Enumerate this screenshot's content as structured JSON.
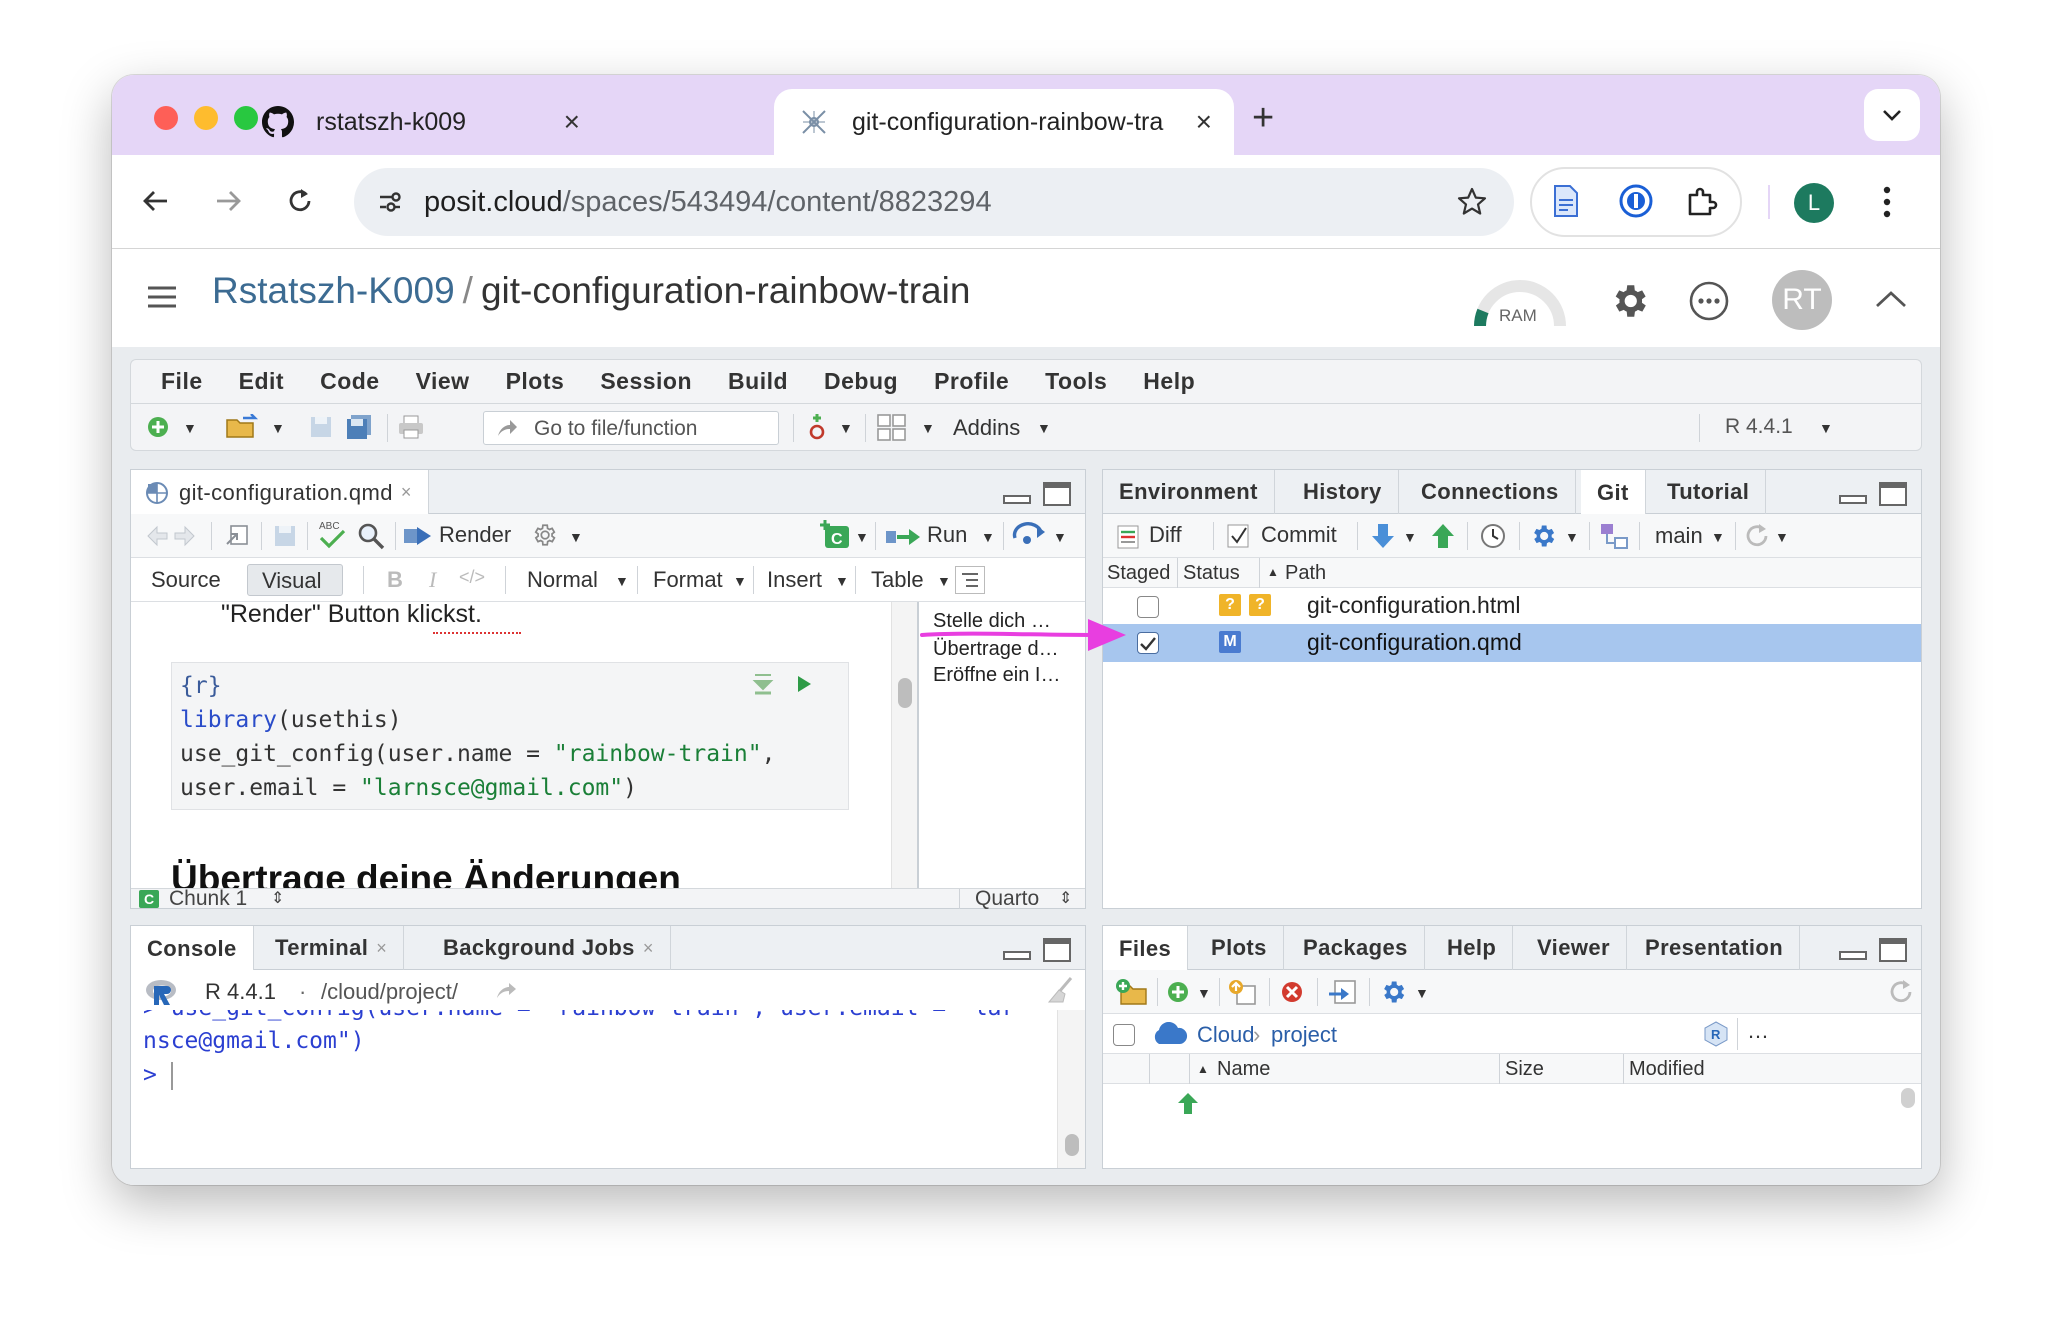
{
  "browser": {
    "tabs": [
      {
        "title": "rstatszh-k009",
        "icon": "github-icon"
      },
      {
        "title": "git-configuration-rainbow-tra",
        "icon": "posit-icon"
      }
    ],
    "url_domain": "posit.cloud",
    "url_path": "/spaces/543494/content/8823294",
    "profile_initial": "L"
  },
  "posit": {
    "space": "Rstatszh-K009",
    "separator": "/",
    "project": "git-configuration-rainbow-train",
    "ram_label": "RAM",
    "user_initials": "RT"
  },
  "menu": [
    "File",
    "Edit",
    "Code",
    "View",
    "Plots",
    "Session",
    "Build",
    "Debug",
    "Profile",
    "Tools",
    "Help"
  ],
  "main_toolbar": {
    "goto_placeholder": "Go to file/function",
    "addins": "Addins",
    "r_version": "R 4.4.1"
  },
  "editor": {
    "file_tab": "git-configuration.qmd",
    "render": "Render",
    "run": "Run",
    "source": "Source",
    "visual": "Visual",
    "format_items": [
      "Normal",
      "Format",
      "Insert",
      "Table"
    ],
    "text_line": "\"Render\" Button klickst.",
    "code_lines": {
      "l1": "{r}",
      "l2_fn": "library",
      "l2_rest": "(usethis)",
      "l3_a": "use_git_config(user.name = ",
      "l3_str": "\"rainbow-train\"",
      "l3_b": ",",
      "l4_a": "user.email = ",
      "l4_str": "\"larnsce@gmail.com\"",
      "l4_b": ")"
    },
    "heading": "Übertrage deine Änderungen",
    "outline": [
      "Stelle dich …",
      "Übertrage d…",
      "Eröffne ein I…"
    ],
    "status_chunk": "Chunk 1",
    "status_type": "Quarto"
  },
  "console": {
    "tabs": [
      "Console",
      "Terminal",
      "Background Jobs"
    ],
    "r_version": "R 4.4.1",
    "dot": "·",
    "path": "/cloud/project/",
    "line_cut": "> use_git_config(user.name = \"rainbow-train\", user.email = \"lar",
    "line2": "nsce@gmail.com\")",
    "prompt": ">"
  },
  "env_pane": {
    "tabs": [
      "Environment",
      "History",
      "Connections",
      "Git",
      "Tutorial"
    ],
    "diff": "Diff",
    "commit": "Commit",
    "branch": "main",
    "col_staged": "Staged",
    "col_status": "Status",
    "col_path": "Path",
    "rows": [
      {
        "staged": false,
        "status": [
          "?",
          "?"
        ],
        "path": "git-configuration.html"
      },
      {
        "staged": true,
        "status": [
          "M"
        ],
        "path": "git-configuration.qmd"
      }
    ],
    "colors": {
      "untracked": "#f0b429",
      "modified": "#4a7bd0",
      "selected_row": "#a7c6ee",
      "arrow": "#e83ee0"
    }
  },
  "files_pane": {
    "tabs": [
      "Files",
      "Plots",
      "Packages",
      "Help",
      "Viewer",
      "Presentation"
    ],
    "crumb_root": "Cloud",
    "crumb_dir": "project",
    "more": "…",
    "col_name": "Name",
    "col_size": "Size",
    "col_modified": "Modified"
  }
}
